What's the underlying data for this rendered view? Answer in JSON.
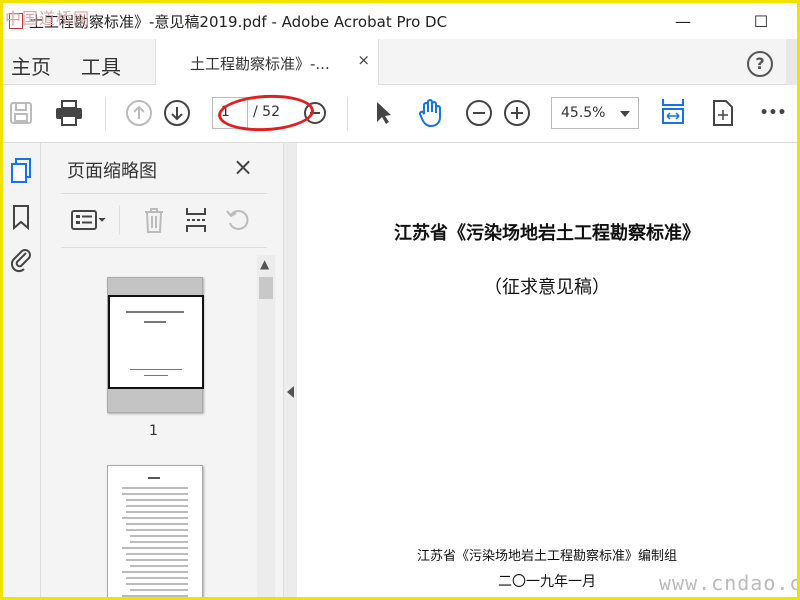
{
  "watermark": {
    "logo": "中国道桥网",
    "site": "www.cndao.com"
  },
  "window": {
    "title": "土工程勘察标准》-意见稿2019.pdf - Adobe Acrobat Pro DC",
    "minimize": "—",
    "maximize": "☐"
  },
  "tabs": {
    "home": "主页",
    "tools": "工具",
    "doc_tab": "土工程勘察标准》-...",
    "close": "×",
    "help": "?"
  },
  "toolbar": {
    "page_current": "1",
    "page_total": "/ 52",
    "zoom": "45.5%",
    "more": "•••"
  },
  "thumbs_panel": {
    "title": "页面缩略图",
    "close": "×",
    "thumbnails": [
      {
        "label": "1"
      }
    ]
  },
  "document": {
    "title": "江苏省《污染场地岩土工程勘察标准》",
    "subtitle": "（征求意见稿）",
    "org": "江苏省《污染场地岩土工程勘察标准》编制组",
    "date": "二〇一九年一月"
  },
  "colors": {
    "accent": "#1473e6",
    "highlight": "#e02020",
    "border": "#f2e200"
  }
}
